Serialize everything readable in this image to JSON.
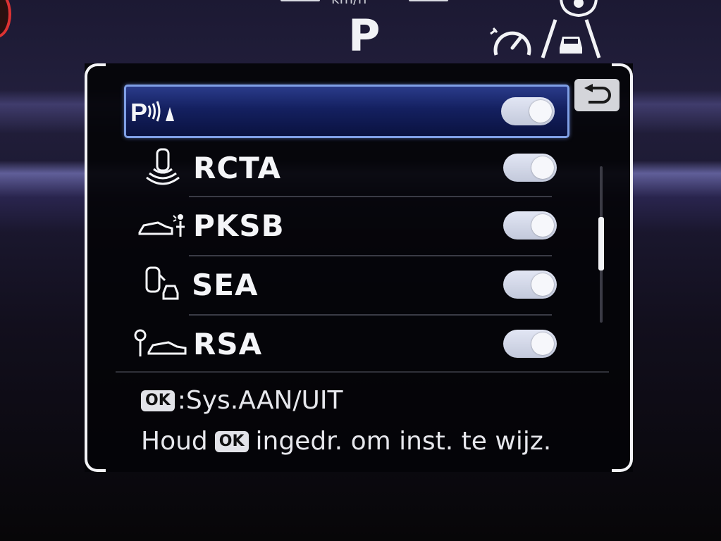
{
  "cluster": {
    "speed_unit": "km/h",
    "gear": "P"
  },
  "menu": {
    "items": [
      {
        "id": "parking-sensor",
        "label": "",
        "icon": "parking-sensor-icon",
        "state": "on",
        "selected": true
      },
      {
        "id": "rcta",
        "label": "RCTA",
        "icon": "rear-cross-traffic-icon",
        "state": "on",
        "selected": false
      },
      {
        "id": "pksb",
        "label": "PKSB",
        "icon": "parking-brake-support-icon",
        "state": "on",
        "selected": false
      },
      {
        "id": "sea",
        "label": "SEA",
        "icon": "safe-exit-assist-icon",
        "state": "on",
        "selected": false
      },
      {
        "id": "rsa",
        "label": "RSA",
        "icon": "road-sign-assist-icon",
        "state": "on",
        "selected": false
      }
    ]
  },
  "hints": {
    "ok_badge": "OK",
    "line1_text": ":Sys.AAN/UIT",
    "line2_prefix": "Houd",
    "line2_suffix": "ingedr. om inst. te wijz."
  },
  "icons": {
    "back": "back-arrow-icon",
    "cruise": "cruise-control-icon",
    "lane": "lane-assist-icon",
    "driver": "driver-monitor-icon"
  },
  "colors": {
    "selection_border": "#7f9fe6",
    "selection_fill": "#142060",
    "toggle_on": "#d6dbea"
  }
}
